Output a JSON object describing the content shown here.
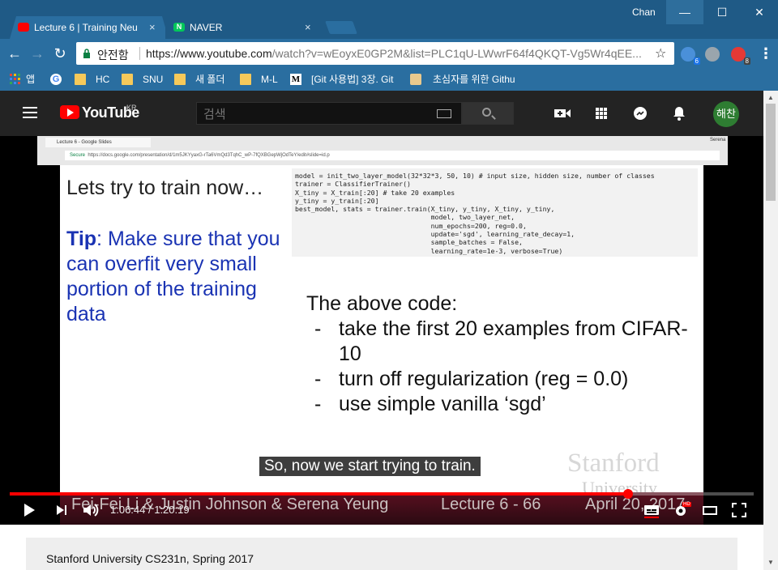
{
  "browser": {
    "user_name": "Chan",
    "tabs": [
      {
        "title": "Lecture 6 | Training Neu",
        "close": "×",
        "favicon_color": "#ff0000"
      },
      {
        "title": "NAVER",
        "close": "×",
        "favicon_color": "#03c75a"
      }
    ],
    "window_controls": {
      "minimize": "—",
      "maximize": "☐",
      "close": "✕"
    },
    "omnibox": {
      "secure_label": "안전함",
      "url_host": "https://www.youtube.com",
      "url_path": "/watch?v=wEoyxE0GP2M&list=PLC1qU-LWwrF64f4QKQT-Vg5Wr4qEE..."
    },
    "extensions": [
      {
        "name": "shield-extension-icon",
        "badge": "6",
        "color": "#4a90d9"
      },
      {
        "name": "globe-extension-icon",
        "badge": "",
        "color": "#9aa5ad"
      },
      {
        "name": "pocket-extension-icon",
        "badge": "8",
        "color": "#e53935"
      }
    ],
    "bookmarks": [
      {
        "label": "앱",
        "icon": "apps-grid-icon"
      },
      {
        "label": "",
        "icon": "google-icon"
      },
      {
        "label": "HC",
        "icon": "folder-icon"
      },
      {
        "label": "SNU",
        "icon": "folder-icon"
      },
      {
        "label": "새 폴더",
        "icon": "folder-icon"
      },
      {
        "label": "M-L",
        "icon": "folder-icon"
      },
      {
        "label": "[Git 사용법] 3장. Git",
        "icon": "medium-icon"
      },
      {
        "label": "초심자를 위한 Githu",
        "icon": "avatar-icon"
      }
    ]
  },
  "youtube": {
    "logo_text": "YouTube",
    "logo_region": "KR",
    "search_placeholder": "검색",
    "avatar_text": "해찬",
    "header_icons": [
      "video-upload-icon",
      "apps-icon",
      "messages-icon",
      "bell-icon"
    ]
  },
  "video": {
    "browser_tab": "Lecture 6 - Google Slides",
    "browser_secure": "Secure",
    "browser_url": "https://docs.google.com/presentation/d/1m5JKYyaxG-rTa6VmQd3TqhC_wP-7fQXBGepWjOdTeY/edit#slide=id.p",
    "browser_user": "Serena",
    "slide": {
      "title": "Lets try to train now…",
      "tip_label": "Tip",
      "tip_text": ": Make sure that you can overfit very small portion of the training data",
      "code": [
        "model = init_two_layer_model(32*32*3, 50, 10) # input size, hidden size, number of classes",
        "trainer = ClassifierTrainer()",
        "X_tiny = X_train[:20] # take 20 examples",
        "y_tiny = y_train[:20]",
        "best_model, stats = trainer.train(X_tiny, y_tiny, X_tiny, y_tiny,",
        "                                  model, two_layer_net,",
        "                                  num_epochs=200, reg=0.0,",
        "                                  update='sgd', learning_rate_decay=1,",
        "                                  sample_batches = False,",
        "                                  learning_rate=1e-3, verbose=True)"
      ],
      "explain_heading": "The above code:",
      "bullets": [
        "take the first 20 examples from CIFAR-10",
        "turn off regularization (reg = 0.0)",
        "use simple vanilla ‘sgd’"
      ],
      "watermark_1": "Stanford",
      "watermark_2": "University",
      "footer_left": "Fei-Fei Li & Justin Johnson & Serena Yeung",
      "footer_mid": "Lecture 6 - 66",
      "footer_right": "April 20, 2017"
    },
    "caption": "So, now we start trying to train.",
    "time_current": "1:06:44",
    "time_total": "1:20:19",
    "time_display": "1:06:44 / 1:20:19",
    "progress_fraction": 0.8309,
    "hd_badge": "HD"
  },
  "below_player": {
    "playlist_title": "Stanford University CS231n, Spring 2017"
  }
}
